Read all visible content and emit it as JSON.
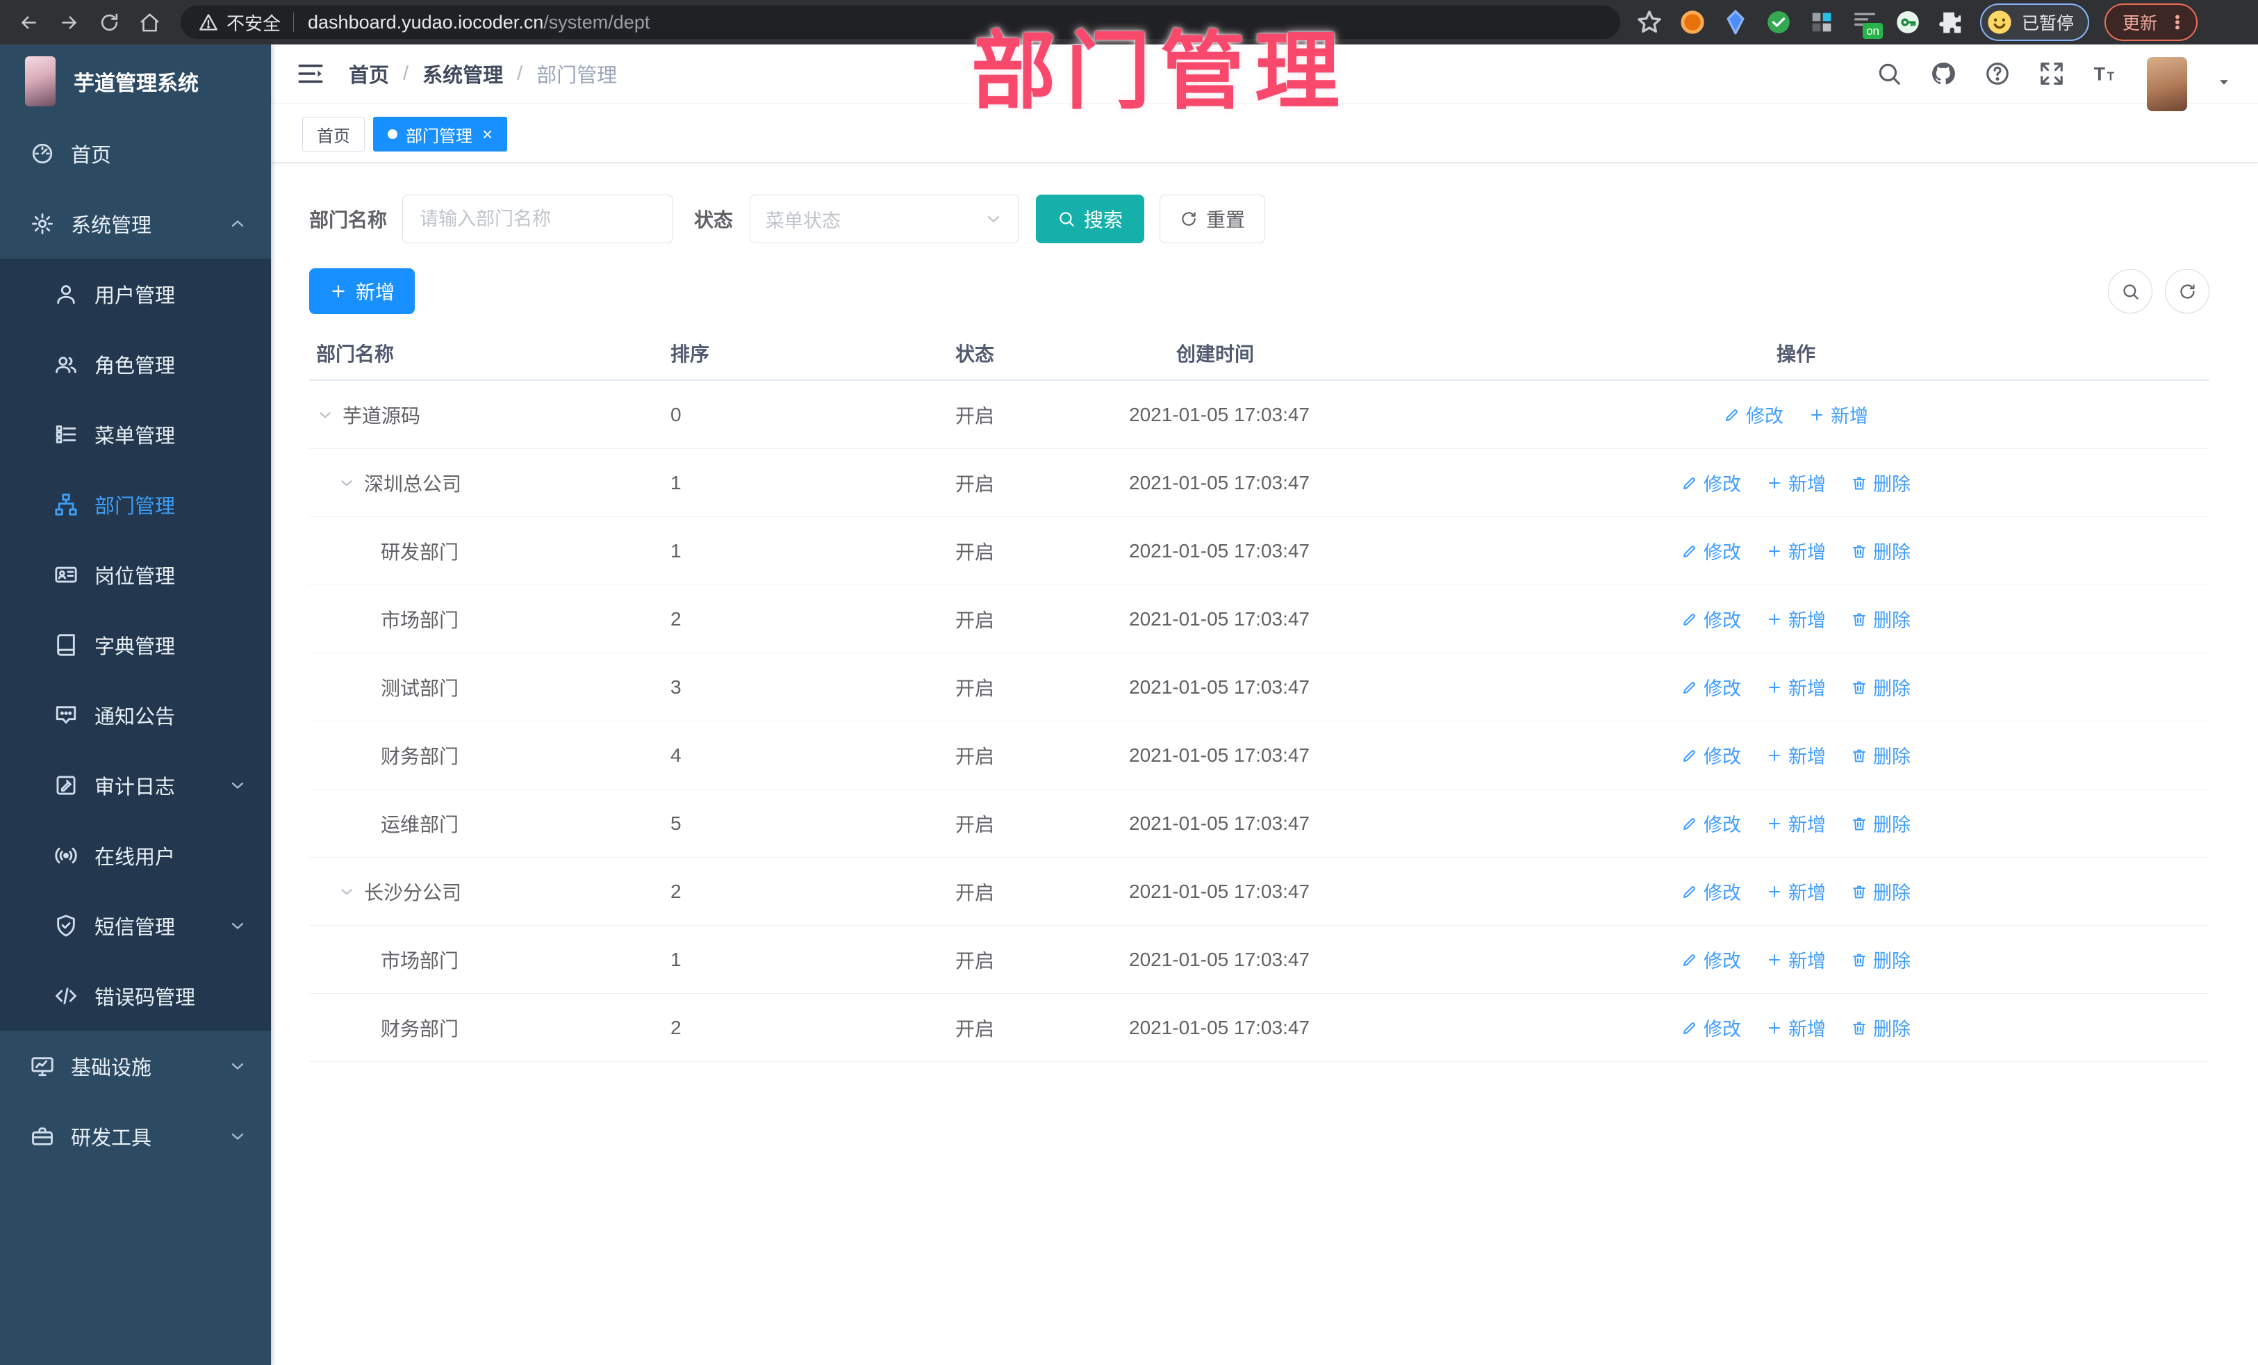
{
  "browser": {
    "security_label": "不安全",
    "url_host": "dashboard.yudao.iocoder.cn",
    "url_path": "/system/dept",
    "extension_badge": "on",
    "extensions": [
      "orange-ring",
      "blue-gem",
      "green-check",
      "grid-squares",
      "screen-on",
      "green-key",
      "puzzle"
    ],
    "profile_chip_label": "已暂停",
    "update_label": "更新"
  },
  "watermark": "部门管理",
  "sidebar": {
    "title": "芋道管理系统",
    "items": [
      {
        "id": "home",
        "label": "首页",
        "icon": "dashboard-icon",
        "group": "top"
      },
      {
        "id": "system-management",
        "label": "系统管理",
        "icon": "gear-icon",
        "group": "top",
        "chevron": "up"
      },
      {
        "id": "user-management",
        "label": "用户管理",
        "icon": "user-icon",
        "group": "sub"
      },
      {
        "id": "role-management",
        "label": "角色管理",
        "icon": "users-icon",
        "group": "sub"
      },
      {
        "id": "menu-management",
        "label": "菜单管理",
        "icon": "menu-list-icon",
        "group": "sub"
      },
      {
        "id": "dept-management",
        "label": "部门管理",
        "icon": "org-tree-icon",
        "group": "sub",
        "active": true
      },
      {
        "id": "post-management",
        "label": "岗位管理",
        "icon": "id-card-icon",
        "group": "sub"
      },
      {
        "id": "dict-management",
        "label": "字典管理",
        "icon": "dictionary-icon",
        "group": "sub"
      },
      {
        "id": "notice-announcement",
        "label": "通知公告",
        "icon": "announcement-icon",
        "group": "sub"
      },
      {
        "id": "audit-log",
        "label": "审计日志",
        "icon": "audit-log-icon",
        "group": "sub",
        "chevron": "down"
      },
      {
        "id": "online-users",
        "label": "在线用户",
        "icon": "online-user-icon",
        "group": "sub"
      },
      {
        "id": "sms-management",
        "label": "短信管理",
        "icon": "sms-shield-icon",
        "group": "sub",
        "chevron": "down"
      },
      {
        "id": "error-code-management",
        "label": "错误码管理",
        "icon": "code-icon",
        "group": "sub"
      },
      {
        "id": "infrastructure",
        "label": "基础设施",
        "icon": "infrastructure-icon",
        "group": "bottom",
        "chevron": "down"
      },
      {
        "id": "dev-tools",
        "label": "研发工具",
        "icon": "dev-tools-icon",
        "group": "bottom",
        "chevron": "down"
      }
    ]
  },
  "header": {
    "breadcrumb": [
      "首页",
      "系统管理",
      "部门管理"
    ]
  },
  "tabs": [
    {
      "label": "首页",
      "active": false
    },
    {
      "label": "部门管理",
      "active": true
    }
  ],
  "filters": {
    "name_label": "部门名称",
    "name_placeholder": "请输入部门名称",
    "status_label": "状态",
    "status_placeholder": "菜单状态",
    "search_label": "搜索",
    "reset_label": "重置"
  },
  "toolbar": {
    "add_label": "新增"
  },
  "table": {
    "headers": [
      "部门名称",
      "排序",
      "状态",
      "创建时间",
      "操作"
    ],
    "action_labels": {
      "edit": "修改",
      "add": "新增",
      "delete": "删除"
    },
    "rows": [
      {
        "name": "芋道源码",
        "indent": 0,
        "expandable": true,
        "sort": "0",
        "status": "开启",
        "created": "2021-01-05 17:03:47",
        "actions": [
          "edit",
          "add"
        ]
      },
      {
        "name": "深圳总公司",
        "indent": 1,
        "expandable": true,
        "sort": "1",
        "status": "开启",
        "created": "2021-01-05 17:03:47",
        "actions": [
          "edit",
          "add",
          "delete"
        ]
      },
      {
        "name": "研发部门",
        "indent": 2,
        "expandable": false,
        "sort": "1",
        "status": "开启",
        "created": "2021-01-05 17:03:47",
        "actions": [
          "edit",
          "add",
          "delete"
        ]
      },
      {
        "name": "市场部门",
        "indent": 2,
        "expandable": false,
        "sort": "2",
        "status": "开启",
        "created": "2021-01-05 17:03:47",
        "actions": [
          "edit",
          "add",
          "delete"
        ]
      },
      {
        "name": "测试部门",
        "indent": 2,
        "expandable": false,
        "sort": "3",
        "status": "开启",
        "created": "2021-01-05 17:03:47",
        "actions": [
          "edit",
          "add",
          "delete"
        ]
      },
      {
        "name": "财务部门",
        "indent": 2,
        "expandable": false,
        "sort": "4",
        "status": "开启",
        "created": "2021-01-05 17:03:47",
        "actions": [
          "edit",
          "add",
          "delete"
        ]
      },
      {
        "name": "运维部门",
        "indent": 2,
        "expandable": false,
        "sort": "5",
        "status": "开启",
        "created": "2021-01-05 17:03:47",
        "actions": [
          "edit",
          "add",
          "delete"
        ]
      },
      {
        "name": "长沙分公司",
        "indent": 1,
        "expandable": true,
        "sort": "2",
        "status": "开启",
        "created": "2021-01-05 17:03:47",
        "actions": [
          "edit",
          "add",
          "delete"
        ]
      },
      {
        "name": "市场部门",
        "indent": 2,
        "expandable": false,
        "sort": "1",
        "status": "开启",
        "created": "2021-01-05 17:03:47",
        "actions": [
          "edit",
          "add",
          "delete"
        ]
      },
      {
        "name": "财务部门",
        "indent": 2,
        "expandable": false,
        "sort": "2",
        "status": "开启",
        "created": "2021-01-05 17:03:47",
        "actions": [
          "edit",
          "add",
          "delete"
        ]
      }
    ]
  },
  "colors": {
    "primary": "#1890ff",
    "teal": "#14b0a9",
    "sidebar_bg": "#2d4a63",
    "submenu_bg": "#23374e",
    "link_blue": "#409eff",
    "watermark_pink": "#f8486b"
  }
}
